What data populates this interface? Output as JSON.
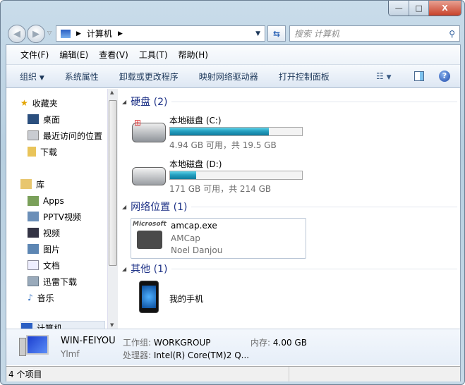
{
  "window": {
    "minimize": "—",
    "maximize": "□",
    "close": "X"
  },
  "nav": {
    "back": "◀",
    "forward": "▶",
    "address_crumb": "计算机",
    "search_placeholder": "搜索 计算机"
  },
  "menu": [
    "文件(F)",
    "编辑(E)",
    "查看(V)",
    "工具(T)",
    "帮助(H)"
  ],
  "toolbar": {
    "organize": "组织",
    "items": [
      "系统属性",
      "卸载或更改程序",
      "映射网络驱动器",
      "打开控制面板"
    ]
  },
  "sidebar": {
    "favorites": {
      "label": "收藏夹",
      "items": [
        "桌面",
        "最近访问的位置",
        "下载"
      ]
    },
    "libraries": {
      "label": "库",
      "items": [
        "Apps",
        "PPTV视频",
        "视频",
        "图片",
        "文档",
        "迅雷下载",
        "音乐"
      ]
    },
    "computer": "计算机"
  },
  "groups": {
    "disks": {
      "title": "硬盘 (2)",
      "drives": [
        {
          "name": "本地磁盘 (C:)",
          "used_fraction": 0.75,
          "info": "4.94 GB 可用，共 19.5 GB"
        },
        {
          "name": "本地磁盘 (D:)",
          "used_fraction": 0.2,
          "info": "171 GB 可用，共 214 GB"
        }
      ]
    },
    "network": {
      "title": "网络位置 (1)",
      "item": {
        "name": "amcap.exe",
        "desc": "AMCap",
        "author": "Noel Danjou",
        "logo": "Microsoft"
      }
    },
    "other": {
      "title": "其他 (1)",
      "item": "我的手机"
    }
  },
  "details": {
    "name": "WIN-FEIYOU",
    "user": "Ylmf",
    "workgroup_label": "工作组:",
    "workgroup": "WORKGROUP",
    "memory_label": "内存:",
    "memory": "4.00 GB",
    "cpu_label": "处理器:",
    "cpu": "Intel(R) Core(TM)2 Q..."
  },
  "status": "4 个项目"
}
